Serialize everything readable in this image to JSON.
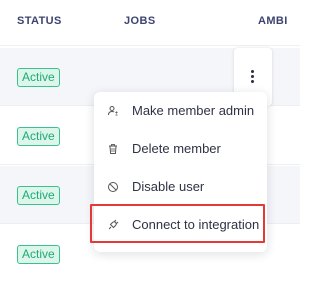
{
  "table": {
    "columns": {
      "status": "STATUS",
      "jobs": "JOBS",
      "ambit": "AMBI"
    },
    "rows": [
      {
        "status": "Active"
      },
      {
        "status": "Active"
      },
      {
        "status": "Active"
      },
      {
        "status": "Active"
      }
    ]
  },
  "row_actions": {
    "icon": "more-vertical-icon"
  },
  "menu": {
    "items": [
      {
        "label": "Make member admin",
        "icon": "user-admin-icon"
      },
      {
        "label": "Delete member",
        "icon": "trash-icon"
      },
      {
        "label": "Disable user",
        "icon": "block-icon"
      },
      {
        "label": "Connect to integration",
        "icon": "plug-icon",
        "highlighted": true
      }
    ]
  },
  "colors": {
    "header_text": "#3d4470",
    "badge_text": "#1faa74",
    "badge_bg": "#dcf6ec",
    "badge_border": "#3cc08d",
    "highlight_border": "#e53935",
    "row_alt_bg": "#f5f6fa"
  }
}
